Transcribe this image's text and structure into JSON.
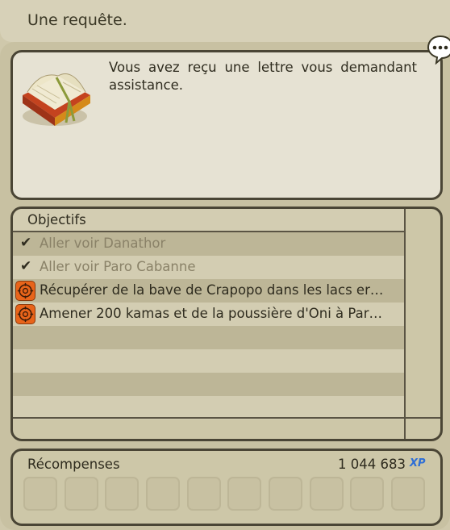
{
  "quest": {
    "title": "Une requête.",
    "description": "Vous avez reçu une lettre vous demandant assistance."
  },
  "objectives": {
    "header": "Objectifs",
    "items": [
      {
        "label": "Aller voir Danathor",
        "status": "done"
      },
      {
        "label": "Aller voir Paro Cabanne",
        "status": "done"
      },
      {
        "label": "Récupérer de la bave de Crapopo dans les lacs er…",
        "status": "active"
      },
      {
        "label": "Amener 200 kamas et de la poussière d'Oni à Par…",
        "status": "active"
      }
    ]
  },
  "rewards": {
    "header": "Récompenses",
    "xp_value": "1 044 683",
    "xp_label": "XP",
    "slot_count": 10
  },
  "icons": {
    "completed": "check-icon",
    "active": "compass-quest-icon",
    "chat": "speech-bubble-icon",
    "quest": "book-icon"
  },
  "colors": {
    "accent_orange": "#e8641a",
    "xp_blue": "#2f6fd6",
    "border": "#4a4535"
  }
}
